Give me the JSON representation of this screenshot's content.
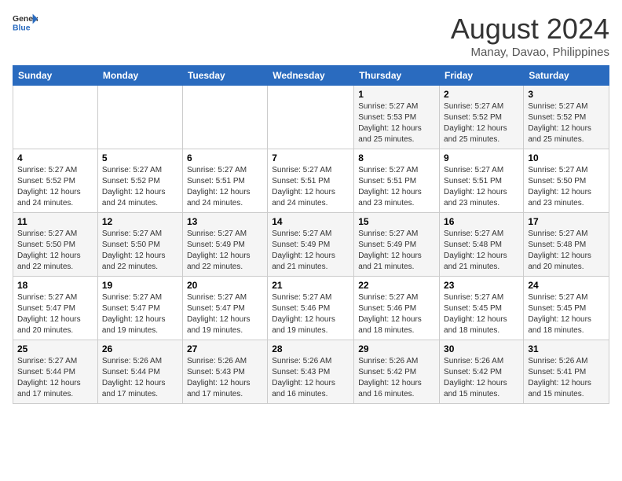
{
  "header": {
    "logo_line1": "General",
    "logo_line2": "Blue",
    "month": "August 2024",
    "location": "Manay, Davao, Philippines"
  },
  "weekdays": [
    "Sunday",
    "Monday",
    "Tuesday",
    "Wednesday",
    "Thursday",
    "Friday",
    "Saturday"
  ],
  "weeks": [
    [
      {
        "day": "",
        "info": ""
      },
      {
        "day": "",
        "info": ""
      },
      {
        "day": "",
        "info": ""
      },
      {
        "day": "",
        "info": ""
      },
      {
        "day": "1",
        "info": "Sunrise: 5:27 AM\nSunset: 5:53 PM\nDaylight: 12 hours\nand 25 minutes."
      },
      {
        "day": "2",
        "info": "Sunrise: 5:27 AM\nSunset: 5:52 PM\nDaylight: 12 hours\nand 25 minutes."
      },
      {
        "day": "3",
        "info": "Sunrise: 5:27 AM\nSunset: 5:52 PM\nDaylight: 12 hours\nand 25 minutes."
      }
    ],
    [
      {
        "day": "4",
        "info": "Sunrise: 5:27 AM\nSunset: 5:52 PM\nDaylight: 12 hours\nand 24 minutes."
      },
      {
        "day": "5",
        "info": "Sunrise: 5:27 AM\nSunset: 5:52 PM\nDaylight: 12 hours\nand 24 minutes."
      },
      {
        "day": "6",
        "info": "Sunrise: 5:27 AM\nSunset: 5:51 PM\nDaylight: 12 hours\nand 24 minutes."
      },
      {
        "day": "7",
        "info": "Sunrise: 5:27 AM\nSunset: 5:51 PM\nDaylight: 12 hours\nand 24 minutes."
      },
      {
        "day": "8",
        "info": "Sunrise: 5:27 AM\nSunset: 5:51 PM\nDaylight: 12 hours\nand 23 minutes."
      },
      {
        "day": "9",
        "info": "Sunrise: 5:27 AM\nSunset: 5:51 PM\nDaylight: 12 hours\nand 23 minutes."
      },
      {
        "day": "10",
        "info": "Sunrise: 5:27 AM\nSunset: 5:50 PM\nDaylight: 12 hours\nand 23 minutes."
      }
    ],
    [
      {
        "day": "11",
        "info": "Sunrise: 5:27 AM\nSunset: 5:50 PM\nDaylight: 12 hours\nand 22 minutes."
      },
      {
        "day": "12",
        "info": "Sunrise: 5:27 AM\nSunset: 5:50 PM\nDaylight: 12 hours\nand 22 minutes."
      },
      {
        "day": "13",
        "info": "Sunrise: 5:27 AM\nSunset: 5:49 PM\nDaylight: 12 hours\nand 22 minutes."
      },
      {
        "day": "14",
        "info": "Sunrise: 5:27 AM\nSunset: 5:49 PM\nDaylight: 12 hours\nand 21 minutes."
      },
      {
        "day": "15",
        "info": "Sunrise: 5:27 AM\nSunset: 5:49 PM\nDaylight: 12 hours\nand 21 minutes."
      },
      {
        "day": "16",
        "info": "Sunrise: 5:27 AM\nSunset: 5:48 PM\nDaylight: 12 hours\nand 21 minutes."
      },
      {
        "day": "17",
        "info": "Sunrise: 5:27 AM\nSunset: 5:48 PM\nDaylight: 12 hours\nand 20 minutes."
      }
    ],
    [
      {
        "day": "18",
        "info": "Sunrise: 5:27 AM\nSunset: 5:47 PM\nDaylight: 12 hours\nand 20 minutes."
      },
      {
        "day": "19",
        "info": "Sunrise: 5:27 AM\nSunset: 5:47 PM\nDaylight: 12 hours\nand 19 minutes."
      },
      {
        "day": "20",
        "info": "Sunrise: 5:27 AM\nSunset: 5:47 PM\nDaylight: 12 hours\nand 19 minutes."
      },
      {
        "day": "21",
        "info": "Sunrise: 5:27 AM\nSunset: 5:46 PM\nDaylight: 12 hours\nand 19 minutes."
      },
      {
        "day": "22",
        "info": "Sunrise: 5:27 AM\nSunset: 5:46 PM\nDaylight: 12 hours\nand 18 minutes."
      },
      {
        "day": "23",
        "info": "Sunrise: 5:27 AM\nSunset: 5:45 PM\nDaylight: 12 hours\nand 18 minutes."
      },
      {
        "day": "24",
        "info": "Sunrise: 5:27 AM\nSunset: 5:45 PM\nDaylight: 12 hours\nand 18 minutes."
      }
    ],
    [
      {
        "day": "25",
        "info": "Sunrise: 5:27 AM\nSunset: 5:44 PM\nDaylight: 12 hours\nand 17 minutes."
      },
      {
        "day": "26",
        "info": "Sunrise: 5:26 AM\nSunset: 5:44 PM\nDaylight: 12 hours\nand 17 minutes."
      },
      {
        "day": "27",
        "info": "Sunrise: 5:26 AM\nSunset: 5:43 PM\nDaylight: 12 hours\nand 17 minutes."
      },
      {
        "day": "28",
        "info": "Sunrise: 5:26 AM\nSunset: 5:43 PM\nDaylight: 12 hours\nand 16 minutes."
      },
      {
        "day": "29",
        "info": "Sunrise: 5:26 AM\nSunset: 5:42 PM\nDaylight: 12 hours\nand 16 minutes."
      },
      {
        "day": "30",
        "info": "Sunrise: 5:26 AM\nSunset: 5:42 PM\nDaylight: 12 hours\nand 15 minutes."
      },
      {
        "day": "31",
        "info": "Sunrise: 5:26 AM\nSunset: 5:41 PM\nDaylight: 12 hours\nand 15 minutes."
      }
    ]
  ]
}
